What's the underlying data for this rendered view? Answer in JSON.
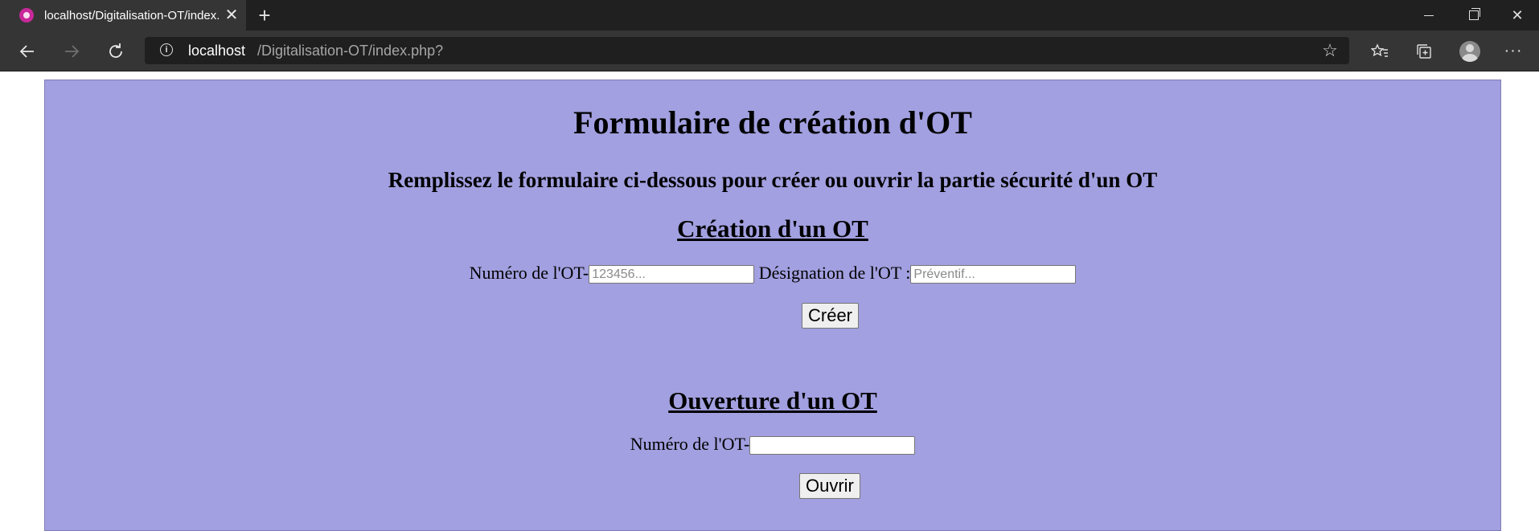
{
  "browser": {
    "tab_title": "localhost/Digitalisation-OT/index.php?",
    "tab_close": "✕",
    "new_tab": "+",
    "url_host": "localhost",
    "url_path": "/Digitalisation-OT/index.php?",
    "window_close": "✕"
  },
  "page": {
    "title": "Formulaire de création d'OT",
    "subtitle": "Remplissez le formulaire ci-dessous pour créer ou ouvrir la partie sécurité d'un OT",
    "create_section": {
      "heading": "Création d'un OT",
      "numero_label": "Numéro de l'OT-",
      "numero_placeholder": "123456...",
      "designation_label": "Désignation de l'OT :",
      "designation_placeholder": "Préventif...",
      "button": "Créer"
    },
    "open_section": {
      "heading": "Ouverture d'un OT",
      "numero_label": "Numéro de l'OT-",
      "numero_value": "",
      "button": "Ouvrir"
    }
  }
}
